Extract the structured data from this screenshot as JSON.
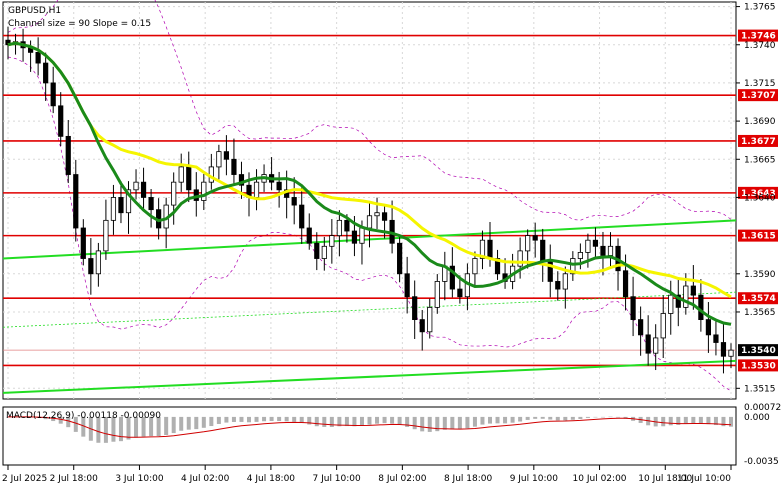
{
  "header": {
    "symbol": "GBPUSD,H1",
    "channel_text": "Channel size = 90 Slope = 0.15"
  },
  "macd": {
    "label": "MACD(12,26,9) -0.00118 -0.00090",
    "ticks": [
      "0.00072",
      "0.000",
      "-0.0035"
    ]
  },
  "colors": {
    "background": "#ffffff",
    "level_line": "#e00000",
    "label_bg": "#e00000",
    "channel_line": "#22dd22",
    "ma_green": "#1a8a1a",
    "ma_yellow": "#f5f500",
    "bollinger": "#b000b0",
    "candle": "#000000",
    "macd_hist": "#b0b0b0",
    "macd_signal": "#d00000",
    "current_price_bg": "#000000"
  },
  "chart_data": {
    "type": "line",
    "symbol": "GBPUSD",
    "timeframe": "H1",
    "ylim": [
      1.3508,
      1.3768
    ],
    "price_ticks": [
      "1.3765",
      "1.3740",
      "1.3715",
      "1.3690",
      "1.3665",
      "1.3640",
      "1.3590",
      "1.3565",
      "1.3515"
    ],
    "levels": [
      {
        "value": 1.3746,
        "label": "1.3746"
      },
      {
        "value": 1.3707,
        "label": "1.3707"
      },
      {
        "value": 1.3677,
        "label": "1.3677"
      },
      {
        "value": 1.3643,
        "label": "1.3643"
      },
      {
        "value": 1.3615,
        "label": "1.3615"
      },
      {
        "value": 1.3574,
        "label": "1.3574"
      },
      {
        "value": 1.353,
        "label": "1.3530"
      }
    ],
    "current_price": {
      "value": 1.354,
      "label": "1.3540"
    },
    "x_labels": [
      "2 Jul 2025",
      "2 Jul 18:00",
      "3 Jul 10:00",
      "4 Jul 02:00",
      "4 Jul 18:00",
      "7 Jul 10:00",
      "8 Jul 02:00",
      "8 Jul 18:00",
      "9 Jul 10:00",
      "10 Jul 02:00",
      "10 Jul 18:00",
      "11 Jul 10:00"
    ],
    "close_series": [
      1.374,
      1.3742,
      1.3738,
      1.3735,
      1.3728,
      1.3715,
      1.37,
      1.368,
      1.3655,
      1.362,
      1.36,
      1.359,
      1.3605,
      1.3625,
      1.364,
      1.363,
      1.3645,
      1.365,
      1.364,
      1.3632,
      1.362,
      1.3635,
      1.365,
      1.366,
      1.3645,
      1.3638,
      1.365,
      1.366,
      1.367,
      1.3665,
      1.3655,
      1.3648,
      1.364,
      1.365,
      1.3655,
      1.365,
      1.3645,
      1.364,
      1.3635,
      1.362,
      1.361,
      1.36,
      1.3608,
      1.3615,
      1.3625,
      1.3618,
      1.361,
      1.362,
      1.3628,
      1.363,
      1.3625,
      1.361,
      1.359,
      1.3575,
      1.356,
      1.3552,
      1.3568,
      1.3585,
      1.3595,
      1.358,
      1.3575,
      1.359,
      1.36,
      1.3612,
      1.36,
      1.359,
      1.3585,
      1.3595,
      1.3605,
      1.3615,
      1.3612,
      1.3598,
      1.3585,
      1.358,
      1.359,
      1.36,
      1.3604,
      1.3612,
      1.3608,
      1.3602,
      1.3608,
      1.3592,
      1.3575,
      1.356,
      1.355,
      1.3538,
      1.3548,
      1.3564,
      1.3576,
      1.3568,
      1.3582,
      1.3576,
      1.356,
      1.355,
      1.3545,
      1.3536,
      1.354
    ]
  }
}
